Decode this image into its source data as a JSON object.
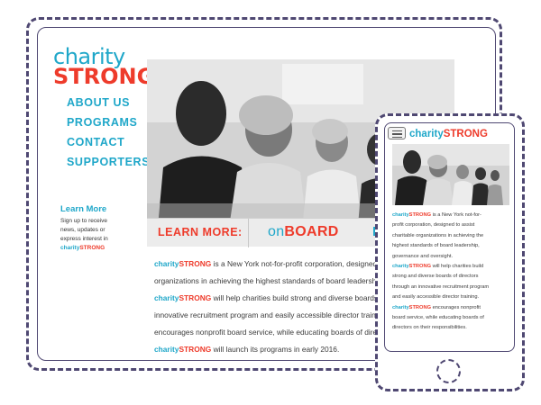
{
  "desktop": {
    "logo": {
      "line1": "charity",
      "line2": "STRONG"
    },
    "nav": [
      {
        "label": "ABOUT US"
      },
      {
        "label": "PROGRAMS"
      },
      {
        "label": "CONTACT"
      },
      {
        "label": "SUPPORTERS"
      }
    ],
    "learn_more": {
      "title": "Learn More",
      "lines": [
        "Sign up to receive",
        "news, updates or",
        "express interest in"
      ],
      "brand_c": "charity",
      "brand_s": "STRONG"
    },
    "banner": {
      "learn": "LEARN MORE:",
      "on": "on",
      "board": "BOARD",
      "tail": "L"
    },
    "body": [
      [
        {
          "t": "charity",
          "c": "c"
        },
        {
          "t": "STRONG",
          "c": "s"
        },
        {
          "t": " is a New York not-for-profit corporation, designed to "
        }
      ],
      [
        {
          "t": "organizations in achieving the highest standards of board leadership, go"
        }
      ],
      [
        {
          "t": "charity",
          "c": "c"
        },
        {
          "t": "STRONG",
          "c": "s"
        },
        {
          "t": " will help charities build strong and diverse boards of "
        }
      ],
      [
        {
          "t": "innovative recruitment program and easily accessible director training. "
        },
        {
          "t": "c",
          "c": "c"
        }
      ],
      [
        {
          "t": "encourages nonprofit board service, while educating boards of directors "
        }
      ],
      [
        {
          "t": "charity",
          "c": "c"
        },
        {
          "t": "STRONG",
          "c": "s"
        },
        {
          "t": " will launch its programs in early 2016."
        }
      ]
    ]
  },
  "mobile": {
    "logo": {
      "c": "charity",
      "s": "STRONG"
    },
    "body": [
      [
        {
          "t": "charity",
          "c": "c"
        },
        {
          "t": "STRONG",
          "c": "s"
        },
        {
          "t": " is a New York not-for-"
        }
      ],
      [
        {
          "t": "profit corporation, designed to assist"
        }
      ],
      [
        {
          "t": "charitable organizations in achieving the"
        }
      ],
      [
        {
          "t": "highest standards of board leadership,"
        }
      ],
      [
        {
          "t": "governance and oversight."
        }
      ],
      [
        {
          "t": "charity",
          "c": "c"
        },
        {
          "t": "STRONG",
          "c": "s"
        },
        {
          "t": " will help charities build"
        }
      ],
      [
        {
          "t": "strong and diverse boards of directors"
        }
      ],
      [
        {
          "t": "through an innovative recruitment program"
        }
      ],
      [
        {
          "t": "and easily accessible director training."
        }
      ],
      [
        {
          "t": "charity",
          "c": "c"
        },
        {
          "t": "STRONG",
          "c": "s"
        },
        {
          "t": " encourages nonprofit"
        }
      ],
      [
        {
          "t": "board service, while educating boards of"
        }
      ],
      [
        {
          "t": "directors on their responsibilities."
        }
      ]
    ]
  },
  "colors": {
    "brand_blue": "#1fa7c9",
    "brand_red": "#ee3b2b",
    "frame": "#4f4872"
  }
}
